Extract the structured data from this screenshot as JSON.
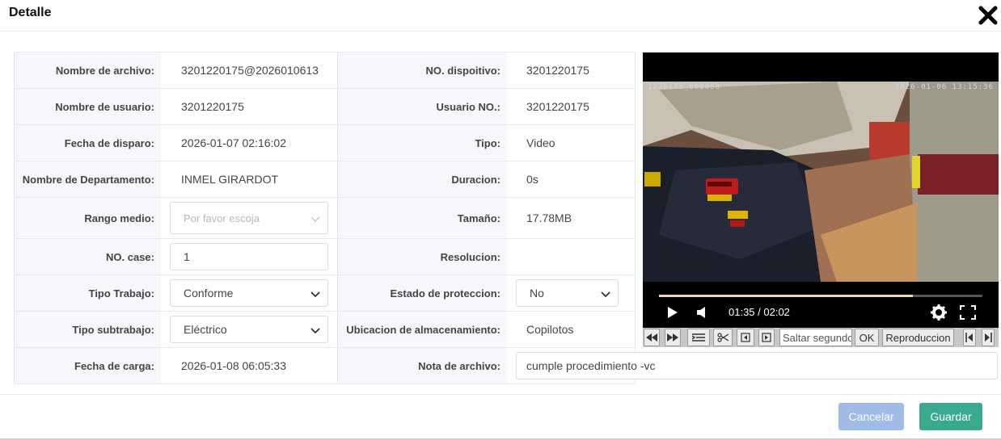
{
  "dialog": {
    "title": "Detalle"
  },
  "fields": {
    "nombre_archivo": {
      "label": "Nombre de archivo:",
      "value": "3201220175@2026010613"
    },
    "no_dispositivo": {
      "label": "NO. dispoitivo:",
      "value": "3201220175"
    },
    "nombre_usuario": {
      "label": "Nombre de usuario:",
      "value": "3201220175"
    },
    "usuario_no": {
      "label": "Usuario NO.:",
      "value": "3201220175"
    },
    "fecha_disparo": {
      "label": "Fecha de disparo:",
      "value": "2026-01-07 02:16:02"
    },
    "tipo": {
      "label": "Tipo:",
      "value": "Video"
    },
    "departamento": {
      "label": "Nombre de Departamento:",
      "value": "INMEL GIRARDOT"
    },
    "duracion": {
      "label": "Duracion:",
      "value": "0s"
    },
    "rango_medio": {
      "label": "Rango medio:",
      "placeholder": "Por favor escoja"
    },
    "tamano": {
      "label": "Tamaño:",
      "value": "17.78MB"
    },
    "no_case": {
      "label": "NO. case:",
      "value": "1"
    },
    "resolucion": {
      "label": "Resolucion:",
      "value": ""
    },
    "tipo_trabajo": {
      "label": "Tipo Trabajo:",
      "value": "Conforme"
    },
    "estado_proteccion": {
      "label": "Estado de proteccion:",
      "value": "No"
    },
    "tipo_subtrabajo": {
      "label": "Tipo subtrabajo:",
      "value": "Eléctrico"
    },
    "ubicacion": {
      "label": "Ubicacion de almacenamiento:",
      "value": "Copilotos"
    },
    "fecha_carga": {
      "label": "Fecha de carga:",
      "value": "2026-01-08 06:05:33"
    },
    "nota_archivo": {
      "label": "Nota de archivo:",
      "value": "cumple procedimiento -vc"
    }
  },
  "player": {
    "osd_left": "1220175_000000",
    "osd_right": "2026-01-06  13:15:36",
    "time": "01:35 / 02:02",
    "progress": 0.785,
    "toolbar": {
      "seek_placeholder": "Saltar segundos",
      "ok_label": "OK",
      "playback_label": "Reproduccion"
    }
  },
  "footer": {
    "cancel_label": "Cancelar",
    "save_label": "Guardar"
  },
  "colors": {
    "cancel": "#a0bce6",
    "save": "#3aaa8f",
    "label_bg": "#f5f7fa"
  }
}
